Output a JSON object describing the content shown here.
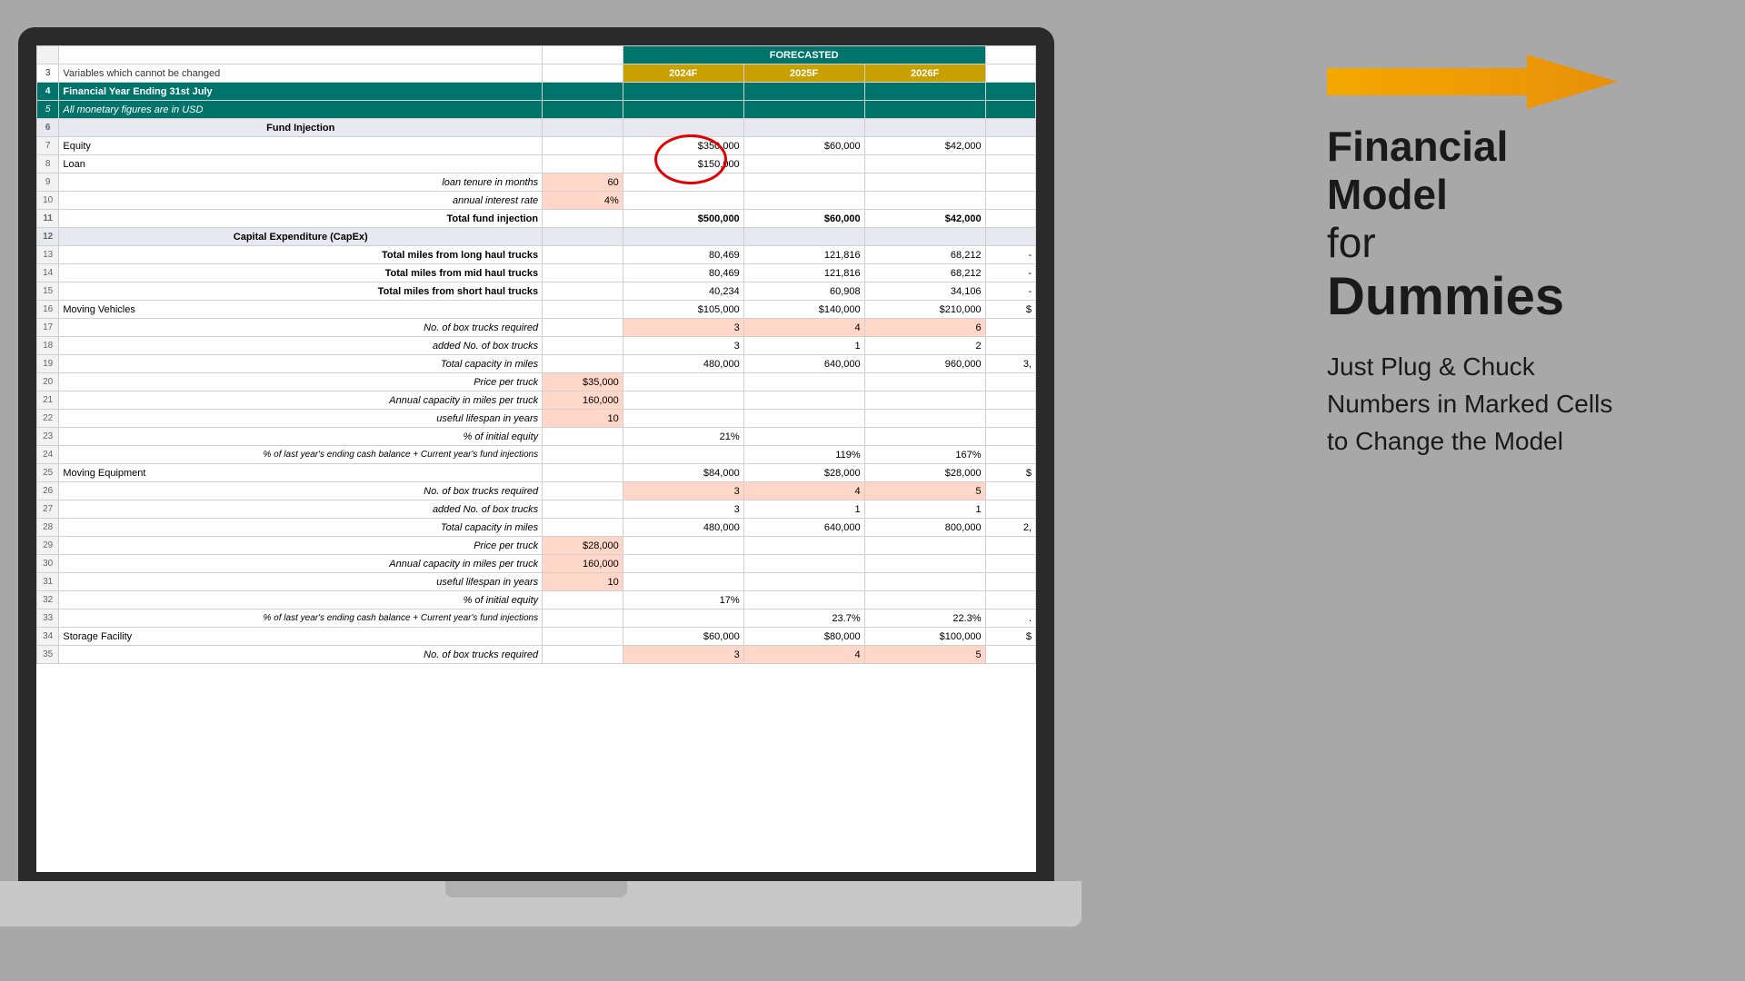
{
  "title": "Financial Model Spreadsheet",
  "rightPanel": {
    "line1": "Financial",
    "line2": "Model",
    "line3": "for",
    "line4": "Dummies",
    "subtitle": "Just Plug & Chuck Numbers in Marked Cells to Change the Model"
  },
  "spreadsheet": {
    "forecastedLabel": "FORECASTED",
    "years": [
      "2024F",
      "2025F",
      "2026F"
    ],
    "rows": [
      {
        "num": "3",
        "label": "Variables which cannot be changed",
        "type": "variables"
      },
      {
        "num": "4",
        "label": "Financial Year Ending 31st July",
        "type": "fy-heading"
      },
      {
        "num": "5",
        "label": "All monetary figures are in USD",
        "type": "monetary"
      },
      {
        "num": "6",
        "label": "Fund Injection",
        "type": "section-header"
      },
      {
        "num": "7",
        "label": "Equity",
        "colB": "",
        "colC": "$350,000",
        "colD": "$60,000",
        "colE": "$42,000"
      },
      {
        "num": "8",
        "label": "Loan",
        "colB": "",
        "colC": "$150,000",
        "colD": "",
        "colE": ""
      },
      {
        "num": "9",
        "label": "loan tenure in months",
        "colB": "60",
        "colC": "",
        "colD": "",
        "colE": "",
        "type": "italic-input"
      },
      {
        "num": "10",
        "label": "annual interest rate",
        "colB": "4%",
        "colC": "",
        "colD": "",
        "colE": "",
        "type": "italic-input"
      },
      {
        "num": "11",
        "label": "Total fund injection",
        "colB": "",
        "colC": "$500,000",
        "colD": "$60,000",
        "colE": "$42,000",
        "type": "total"
      },
      {
        "num": "12",
        "label": "Capital Expenditure (CapEx)",
        "type": "section-header"
      },
      {
        "num": "13",
        "label": "Total miles from long haul trucks",
        "colB": "",
        "colC": "80,469",
        "colD": "121,816",
        "colE": "68,212",
        "colF": "-"
      },
      {
        "num": "14",
        "label": "Total miles from mid haul trucks",
        "colB": "",
        "colC": "80,469",
        "colD": "121,816",
        "colE": "68,212",
        "colF": "-"
      },
      {
        "num": "15",
        "label": "Total miles from short haul trucks",
        "colB": "",
        "colC": "40,234",
        "colD": "60,908",
        "colE": "34,106",
        "colF": "-"
      },
      {
        "num": "16",
        "label": "Moving Vehicles",
        "colB": "",
        "colC": "$105,000",
        "colD": "$140,000",
        "colE": "$210,000",
        "colF": "$"
      },
      {
        "num": "17",
        "label": "No. of box trucks required",
        "colB": "",
        "colC": "3",
        "colD": "4",
        "colE": "6",
        "type": "italic-salmon"
      },
      {
        "num": "18",
        "label": "added No. of box trucks",
        "colB": "",
        "colC": "3",
        "colD": "1",
        "colE": "2",
        "type": "italic"
      },
      {
        "num": "19",
        "label": "Total capacity in miles",
        "colB": "",
        "colC": "480,000",
        "colD": "640,000",
        "colE": "960,000",
        "colF": "3,",
        "type": "italic"
      },
      {
        "num": "20",
        "label": "Price per truck",
        "colB": "$35,000",
        "colC": "",
        "colD": "",
        "colE": "",
        "type": "italic-input"
      },
      {
        "num": "21",
        "label": "Annual capacity in miles per truck",
        "colB": "160,000",
        "colC": "",
        "colD": "",
        "colE": "",
        "type": "italic-input"
      },
      {
        "num": "22",
        "label": "useful lifespan in years",
        "colB": "10",
        "colC": "",
        "colD": "",
        "colE": "",
        "type": "italic-input"
      },
      {
        "num": "23",
        "label": "% of initial equity",
        "colB": "",
        "colC": "21%",
        "colD": "",
        "colE": "",
        "type": "italic"
      },
      {
        "num": "24",
        "label": "% of last year's ending cash balance + Current year's fund injections",
        "colB": "",
        "colC": "",
        "colD": "119%",
        "colE": "167%",
        "type": "italic"
      },
      {
        "num": "25",
        "label": "Moving Equipment",
        "colB": "",
        "colC": "$84,000",
        "colD": "$28,000",
        "colE": "$28,000",
        "colF": "$"
      },
      {
        "num": "26",
        "label": "No. of box trucks required",
        "colB": "",
        "colC": "3",
        "colD": "4",
        "colE": "5",
        "type": "italic-salmon"
      },
      {
        "num": "27",
        "label": "added No. of box trucks",
        "colB": "",
        "colC": "3",
        "colD": "1",
        "colE": "1",
        "type": "italic"
      },
      {
        "num": "28",
        "label": "Total capacity in miles",
        "colB": "",
        "colC": "480,000",
        "colD": "640,000",
        "colE": "800,000",
        "colF": "2,",
        "type": "italic"
      },
      {
        "num": "29",
        "label": "Price per truck",
        "colB": "$28,000",
        "colC": "",
        "colD": "",
        "colE": "",
        "type": "italic-input"
      },
      {
        "num": "30",
        "label": "Annual capacity in miles per truck",
        "colB": "160,000",
        "colC": "",
        "colD": "",
        "colE": "",
        "type": "italic-input"
      },
      {
        "num": "31",
        "label": "useful lifespan in years",
        "colB": "10",
        "colC": "",
        "colD": "",
        "colE": "",
        "type": "italic-input"
      },
      {
        "num": "32",
        "label": "% of initial equity",
        "colB": "",
        "colC": "17%",
        "colD": "",
        "colE": "",
        "type": "italic"
      },
      {
        "num": "33",
        "label": "% of last year's ending cash balance + Current year's fund injections",
        "colB": "",
        "colC": "",
        "colD": "23.7%",
        "colE": "22.3%",
        "colF": ".",
        "type": "italic"
      },
      {
        "num": "34",
        "label": "Storage Facility",
        "colB": "",
        "colC": "$60,000",
        "colD": "$80,000",
        "colE": "$100,000",
        "colF": "$"
      },
      {
        "num": "35",
        "label": "No. of box trucks required",
        "colB": "",
        "colC": "3",
        "colD": "4",
        "colE": "5",
        "type": "italic-salmon"
      }
    ]
  }
}
